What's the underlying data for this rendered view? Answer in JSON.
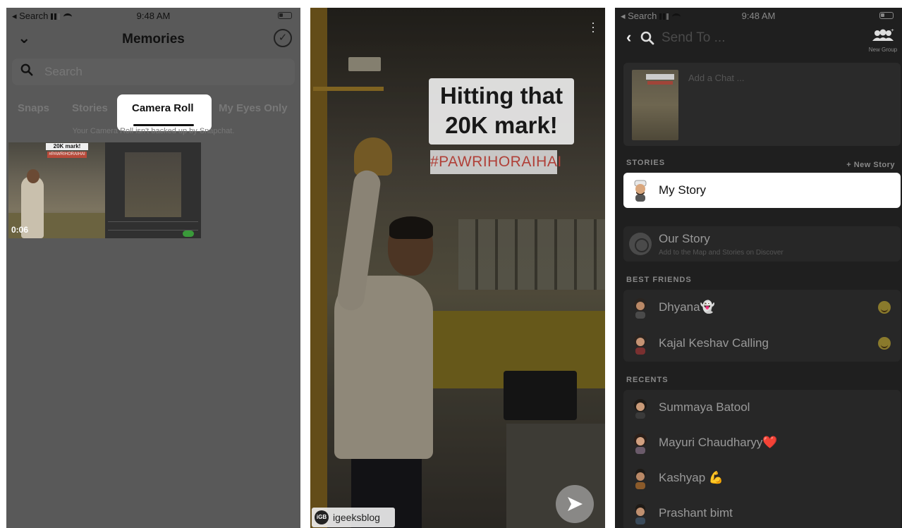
{
  "panel1": {
    "status": {
      "back": "◂ Search",
      "time": "9:48 AM"
    },
    "header": {
      "title": "Memories"
    },
    "search": {
      "placeholder": "Search"
    },
    "tabs": [
      {
        "label": "Snaps",
        "active": false
      },
      {
        "label": "Stories",
        "active": false
      },
      {
        "label": "Camera Roll",
        "active": true
      },
      {
        "label": "My Eyes Only",
        "active": false
      }
    ],
    "note": "Your Camera Roll isn't backed up by Snapchat.",
    "thumbs": [
      {
        "banner": "20K mark!",
        "tag": "#PAWRIHORAIHAI",
        "duration": "0:06"
      },
      {
        "kind": "screenshot"
      }
    ]
  },
  "panel2": {
    "caption_line1": "Hitting that",
    "caption_line2": "20K mark!",
    "hashtag": "#PAWRIHORAIHAI",
    "watermark_logo": "iGB",
    "watermark_text": "igeeksblog"
  },
  "panel3": {
    "status": {
      "back": "◂ Search",
      "time": "9:48 AM"
    },
    "header": {
      "placeholder": "Send To ...",
      "new_group": "New Group"
    },
    "chat_placeholder": "Add a Chat ...",
    "sections": {
      "stories": "STORIES",
      "new_story": "+ New Story",
      "best_friends": "BEST FRIENDS",
      "recents": "RECENTS"
    },
    "stories": [
      {
        "name": "My Story",
        "sub": ""
      },
      {
        "name": "Our Story",
        "sub": "Add to the Map and Stories on Discover"
      }
    ],
    "best_friends": [
      {
        "name": "Dhyana👻"
      },
      {
        "name": "Kajal Keshav Calling"
      }
    ],
    "recents": [
      {
        "name": "Summaya Batool"
      },
      {
        "name": "Mayuri Chaudharyy❤️"
      },
      {
        "name": "Kashyap 💪"
      },
      {
        "name": "Prashant bimt"
      }
    ]
  },
  "colors": {
    "dim_overlay": "#595959",
    "highlight": "#ffffff",
    "hashtag_red": "#b04038",
    "emoji_gold": "#8a7a2c"
  }
}
